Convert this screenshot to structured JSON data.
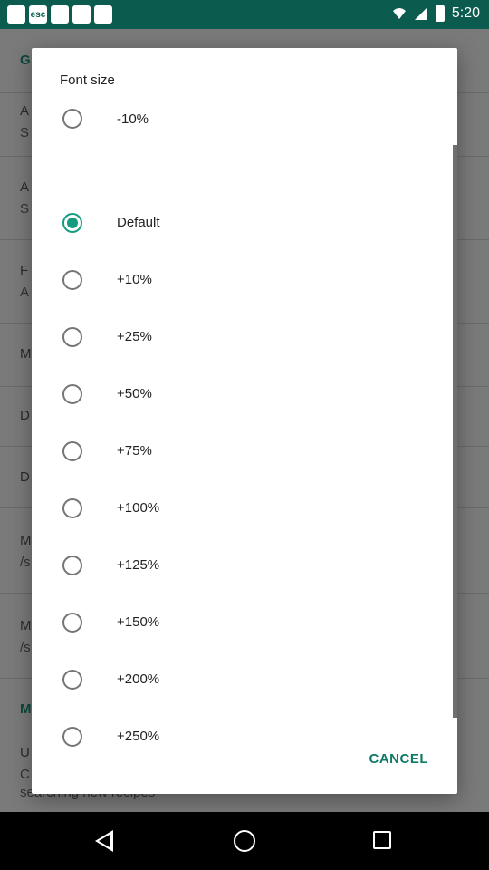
{
  "status_bar": {
    "time": "5:20",
    "left_icons": [
      "",
      "esc",
      "",
      "",
      ""
    ]
  },
  "background": {
    "rows": [
      {
        "title": "G",
        "sub": ""
      },
      {
        "title": "A",
        "sub": "S"
      },
      {
        "title": "A",
        "sub": "S"
      },
      {
        "title": "F",
        "sub": "A"
      },
      {
        "title": "M",
        "sub": ""
      },
      {
        "title": "D",
        "sub": ""
      },
      {
        "title": "D",
        "sub": ""
      },
      {
        "title": "M",
        "sub": "/s"
      },
      {
        "title": "M",
        "sub": "/s"
      },
      {
        "title": "M",
        "sub": ""
      },
      {
        "title": "U",
        "sub": "C"
      },
      {
        "title": "",
        "sub": "searching new recipes"
      }
    ]
  },
  "dialog": {
    "title": "Font size",
    "options": [
      {
        "label": "-10%",
        "checked": false
      },
      {
        "label": "Default",
        "checked": true
      },
      {
        "label": "+10%",
        "checked": false
      },
      {
        "label": "+25%",
        "checked": false
      },
      {
        "label": "+50%",
        "checked": false
      },
      {
        "label": "+75%",
        "checked": false
      },
      {
        "label": "+100%",
        "checked": false
      },
      {
        "label": "+125%",
        "checked": false
      },
      {
        "label": "+150%",
        "checked": false
      },
      {
        "label": "+200%",
        "checked": false
      },
      {
        "label": "+250%",
        "checked": false
      }
    ],
    "cancel_label": "CANCEL"
  },
  "colors": {
    "accent": "#179b80",
    "status_bar": "#0b5c4e"
  }
}
